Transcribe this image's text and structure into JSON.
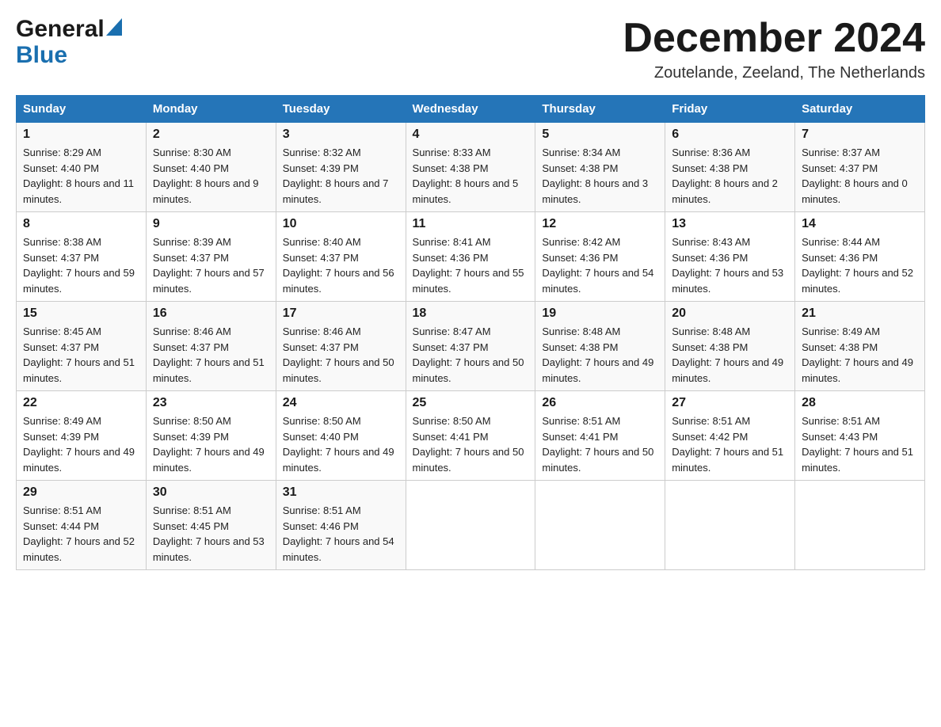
{
  "header": {
    "logo_general": "General",
    "logo_blue": "Blue",
    "month_title": "December 2024",
    "location": "Zoutelande, Zeeland, The Netherlands"
  },
  "days_of_week": [
    "Sunday",
    "Monday",
    "Tuesday",
    "Wednesday",
    "Thursday",
    "Friday",
    "Saturday"
  ],
  "weeks": [
    [
      {
        "day": "1",
        "sunrise": "8:29 AM",
        "sunset": "4:40 PM",
        "daylight": "8 hours and 11 minutes."
      },
      {
        "day": "2",
        "sunrise": "8:30 AM",
        "sunset": "4:40 PM",
        "daylight": "8 hours and 9 minutes."
      },
      {
        "day": "3",
        "sunrise": "8:32 AM",
        "sunset": "4:39 PM",
        "daylight": "8 hours and 7 minutes."
      },
      {
        "day": "4",
        "sunrise": "8:33 AM",
        "sunset": "4:38 PM",
        "daylight": "8 hours and 5 minutes."
      },
      {
        "day": "5",
        "sunrise": "8:34 AM",
        "sunset": "4:38 PM",
        "daylight": "8 hours and 3 minutes."
      },
      {
        "day": "6",
        "sunrise": "8:36 AM",
        "sunset": "4:38 PM",
        "daylight": "8 hours and 2 minutes."
      },
      {
        "day": "7",
        "sunrise": "8:37 AM",
        "sunset": "4:37 PM",
        "daylight": "8 hours and 0 minutes."
      }
    ],
    [
      {
        "day": "8",
        "sunrise": "8:38 AM",
        "sunset": "4:37 PM",
        "daylight": "7 hours and 59 minutes."
      },
      {
        "day": "9",
        "sunrise": "8:39 AM",
        "sunset": "4:37 PM",
        "daylight": "7 hours and 57 minutes."
      },
      {
        "day": "10",
        "sunrise": "8:40 AM",
        "sunset": "4:37 PM",
        "daylight": "7 hours and 56 minutes."
      },
      {
        "day": "11",
        "sunrise": "8:41 AM",
        "sunset": "4:36 PM",
        "daylight": "7 hours and 55 minutes."
      },
      {
        "day": "12",
        "sunrise": "8:42 AM",
        "sunset": "4:36 PM",
        "daylight": "7 hours and 54 minutes."
      },
      {
        "day": "13",
        "sunrise": "8:43 AM",
        "sunset": "4:36 PM",
        "daylight": "7 hours and 53 minutes."
      },
      {
        "day": "14",
        "sunrise": "8:44 AM",
        "sunset": "4:36 PM",
        "daylight": "7 hours and 52 minutes."
      }
    ],
    [
      {
        "day": "15",
        "sunrise": "8:45 AM",
        "sunset": "4:37 PM",
        "daylight": "7 hours and 51 minutes."
      },
      {
        "day": "16",
        "sunrise": "8:46 AM",
        "sunset": "4:37 PM",
        "daylight": "7 hours and 51 minutes."
      },
      {
        "day": "17",
        "sunrise": "8:46 AM",
        "sunset": "4:37 PM",
        "daylight": "7 hours and 50 minutes."
      },
      {
        "day": "18",
        "sunrise": "8:47 AM",
        "sunset": "4:37 PM",
        "daylight": "7 hours and 50 minutes."
      },
      {
        "day": "19",
        "sunrise": "8:48 AM",
        "sunset": "4:38 PM",
        "daylight": "7 hours and 49 minutes."
      },
      {
        "day": "20",
        "sunrise": "8:48 AM",
        "sunset": "4:38 PM",
        "daylight": "7 hours and 49 minutes."
      },
      {
        "day": "21",
        "sunrise": "8:49 AM",
        "sunset": "4:38 PM",
        "daylight": "7 hours and 49 minutes."
      }
    ],
    [
      {
        "day": "22",
        "sunrise": "8:49 AM",
        "sunset": "4:39 PM",
        "daylight": "7 hours and 49 minutes."
      },
      {
        "day": "23",
        "sunrise": "8:50 AM",
        "sunset": "4:39 PM",
        "daylight": "7 hours and 49 minutes."
      },
      {
        "day": "24",
        "sunrise": "8:50 AM",
        "sunset": "4:40 PM",
        "daylight": "7 hours and 49 minutes."
      },
      {
        "day": "25",
        "sunrise": "8:50 AM",
        "sunset": "4:41 PM",
        "daylight": "7 hours and 50 minutes."
      },
      {
        "day": "26",
        "sunrise": "8:51 AM",
        "sunset": "4:41 PM",
        "daylight": "7 hours and 50 minutes."
      },
      {
        "day": "27",
        "sunrise": "8:51 AM",
        "sunset": "4:42 PM",
        "daylight": "7 hours and 51 minutes."
      },
      {
        "day": "28",
        "sunrise": "8:51 AM",
        "sunset": "4:43 PM",
        "daylight": "7 hours and 51 minutes."
      }
    ],
    [
      {
        "day": "29",
        "sunrise": "8:51 AM",
        "sunset": "4:44 PM",
        "daylight": "7 hours and 52 minutes."
      },
      {
        "day": "30",
        "sunrise": "8:51 AM",
        "sunset": "4:45 PM",
        "daylight": "7 hours and 53 minutes."
      },
      {
        "day": "31",
        "sunrise": "8:51 AM",
        "sunset": "4:46 PM",
        "daylight": "7 hours and 54 minutes."
      },
      null,
      null,
      null,
      null
    ]
  ],
  "labels": {
    "sunrise": "Sunrise:",
    "sunset": "Sunset:",
    "daylight": "Daylight:"
  }
}
